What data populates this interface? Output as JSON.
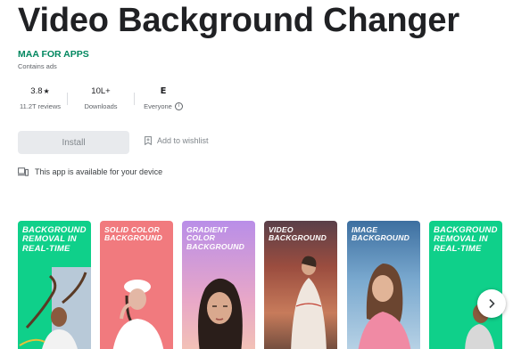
{
  "app": {
    "title": "Video Background Changer",
    "developer": "MAA FOR APPS",
    "contains_ads": "Contains ads"
  },
  "stats": {
    "rating": "3.8",
    "reviews": "11.2T reviews",
    "downloads_value": "10L+",
    "downloads_label": "Downloads",
    "content_rating_badge": "E",
    "content_rating_label": "Everyone"
  },
  "actions": {
    "install_label": "Install",
    "wishlist_label": "Add to wishlist"
  },
  "availability": "This app is available for your device",
  "screenshots": [
    {
      "caption": "BACKGROUND REMOVAL IN REAL-TIME"
    },
    {
      "caption": "SOLID COLOR BACKGROUND"
    },
    {
      "caption": "GRADIENT COLOR BACKGROUND"
    },
    {
      "caption": "VIDEO BACKGROUND"
    },
    {
      "caption": "IMAGE BACKGROUND"
    },
    {
      "caption": "BACKGROUND REMOVAL IN REAL-TIME"
    }
  ],
  "colors": {
    "brand_green": "#01875f",
    "install_bg": "#e8eaed",
    "screenshot_green": "#0fd08a",
    "screenshot_coral": "#f17a7e"
  },
  "icons": [
    "star-icon",
    "esrb-everyone-icon",
    "info-icon",
    "wishlist-icon",
    "device-icon",
    "chevron-right-icon"
  ]
}
